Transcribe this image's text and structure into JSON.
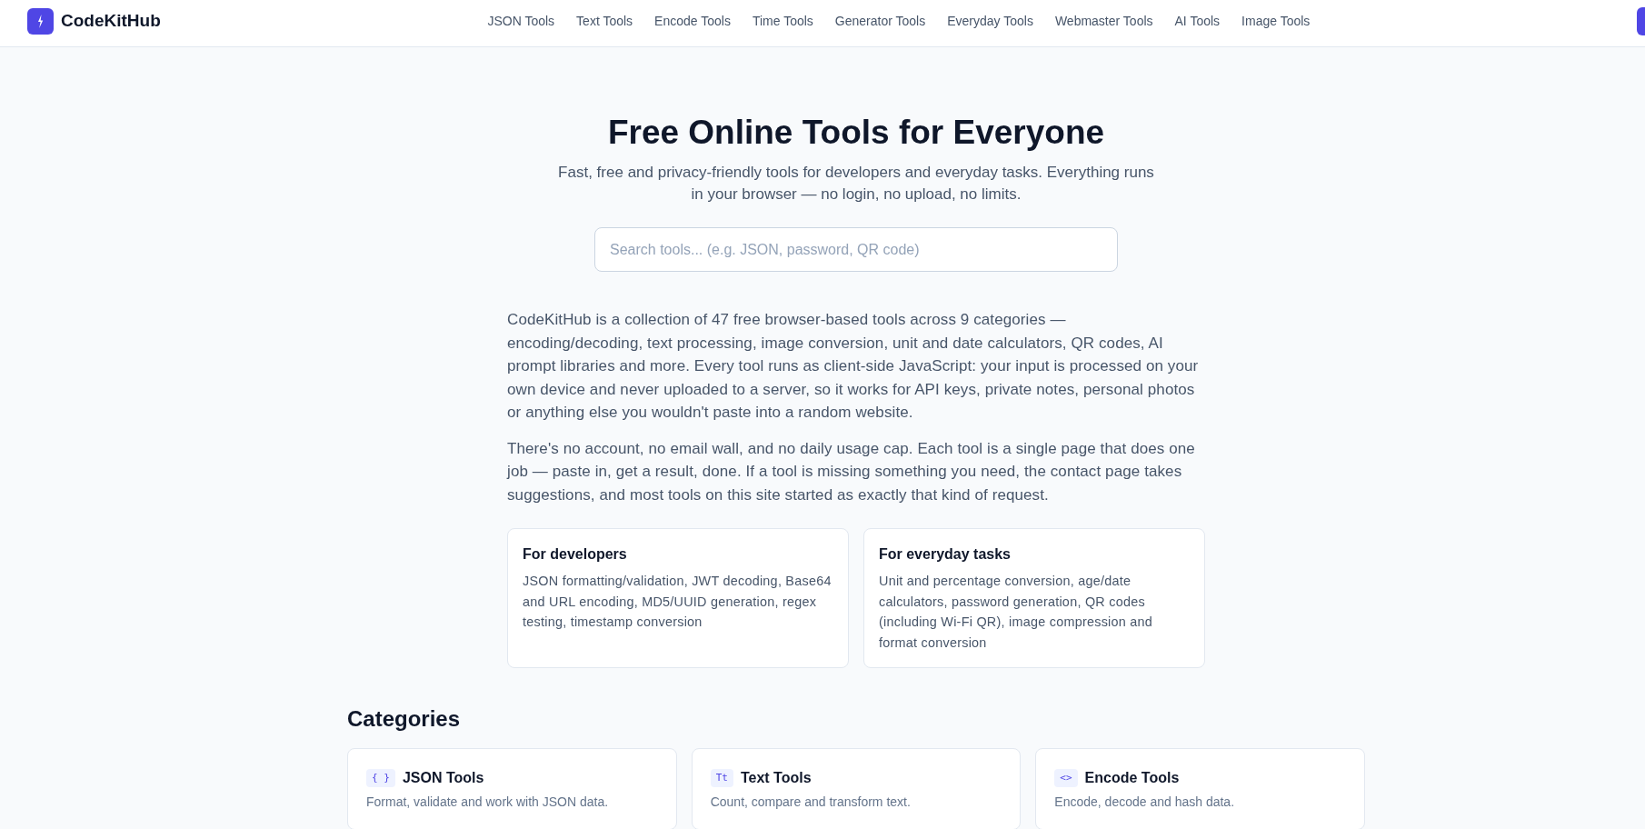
{
  "header": {
    "brand": "CodeKitHub",
    "nav": [
      {
        "label": "JSON Tools"
      },
      {
        "label": "Text Tools"
      },
      {
        "label": "Encode Tools"
      },
      {
        "label": "Time Tools"
      },
      {
        "label": "Generator Tools"
      },
      {
        "label": "Everyday Tools"
      },
      {
        "label": "Webmaster Tools"
      },
      {
        "label": "AI Tools"
      },
      {
        "label": "Image Tools"
      }
    ]
  },
  "hero": {
    "title": "Free Online Tools for Everyone",
    "subtitle": "Fast, free and privacy-friendly tools for developers and everyday tasks. Everything runs in your browser — no login, no upload, no limits.",
    "search": {
      "placeholder": "Search tools... (e.g. JSON, password, QR code)"
    }
  },
  "intro": {
    "paragraphs": [
      "CodeKitHub is a collection of 47 free browser-based tools across 9 categories —\nencoding/decoding, text processing, image conversion, unit and date calculators, QR codes, AI prompt libraries and more. Every tool runs as client-side JavaScript: your input is processed on your own device and never uploaded to a server, so it works for API keys, private notes, personal photos or anything else you wouldn't paste into a random website.",
      "There's no account, no email wall, and no daily usage cap. Each tool is a single page that does one job — paste in, get a result, done. If a tool is missing something you need, the contact page takes suggestions, and most tools on this site started as exactly that kind of request."
    ]
  },
  "audience_cards": [
    {
      "title": "For developers",
      "text": "JSON formatting/validation, JWT decoding, Base64 and URL encoding, MD5/UUID generation, regex testing, timestamp conversion"
    },
    {
      "title": "For everyday tasks",
      "text": "Unit and percentage conversion, age/date calculators, password generation, QR codes (including Wi-Fi QR), image compression and format conversion"
    }
  ],
  "categories": {
    "title": "Categories",
    "items": [
      {
        "icon": "{ }",
        "name": "JSON Tools",
        "description": "Format, validate and work with JSON data."
      },
      {
        "icon": "Tt",
        "name": "Text Tools",
        "description": "Count, compare and transform text."
      },
      {
        "icon": "<>",
        "name": "Encode Tools",
        "description": "Encode, decode and hash data."
      }
    ]
  }
}
